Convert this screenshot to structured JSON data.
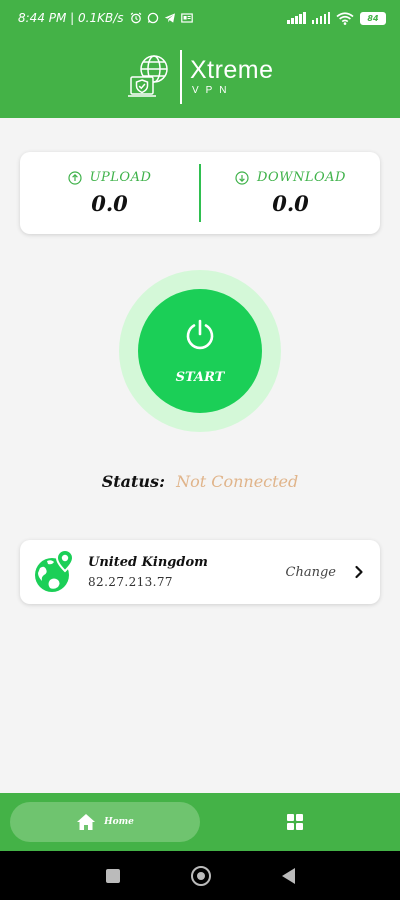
{
  "status_bar": {
    "time_speed": "8:44 PM | 0.1KB/s",
    "battery": "84",
    "icons": [
      "alarm-icon",
      "whatsapp-icon",
      "telegram-icon",
      "app-icon",
      "signal-icon",
      "signal-icon",
      "wifi-icon",
      "battery-icon"
    ]
  },
  "header": {
    "title": "Xtreme",
    "subtitle": "VPN",
    "logo_icon": "globe-laptop-shield-icon",
    "background": "#44b247"
  },
  "speed": {
    "upload_label": "UPLOAD",
    "upload_value": "0.0",
    "download_label": "DOWNLOAD",
    "download_value": "0.0",
    "accent": "#3fb24a"
  },
  "connect": {
    "label": "START",
    "icon": "power-icon",
    "button_color": "#1bcf57",
    "ring_color": "#d4f8d8"
  },
  "status": {
    "label": "Status:",
    "value": "Not Connected",
    "value_color": "#e0b48a"
  },
  "server": {
    "country": "United Kingdom",
    "ip": "82.27.213.77",
    "change_label": "Change",
    "icon": "globe-location-icon"
  },
  "bottom_nav": {
    "home_label": "Home",
    "home_icon": "home-icon",
    "grid_icon": "grid-icon"
  },
  "system_nav": [
    "recents-square-icon",
    "home-circle-icon",
    "back-triangle-icon"
  ]
}
